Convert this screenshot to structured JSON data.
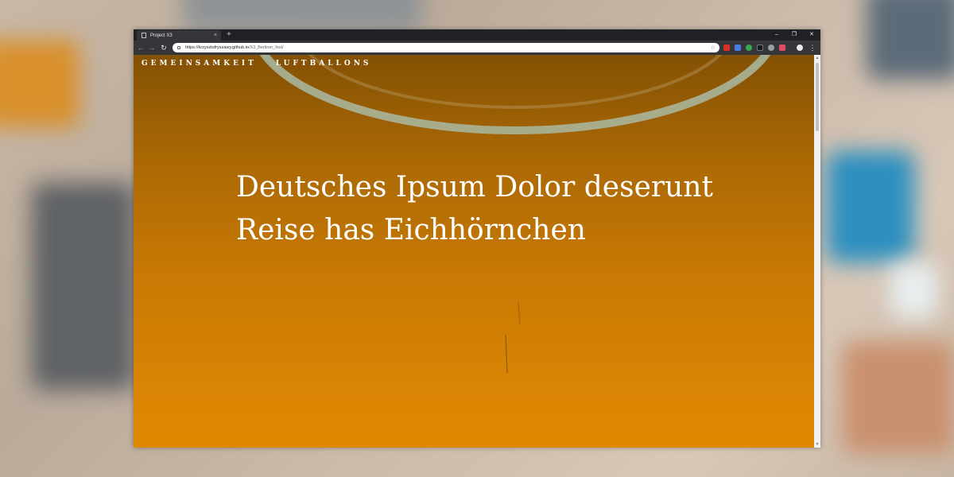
{
  "browser": {
    "tab_title": "Project X3",
    "url_host": "https://krzysztofryszawy.github.io",
    "url_path": "/X3_Berliner_fest/",
    "new_tab": "+",
    "tab_close": "×",
    "window_controls": {
      "minimize": "–",
      "restore": "❐",
      "close": "✕"
    },
    "nav_icons": {
      "back": "←",
      "forward": "→",
      "reload": "↻",
      "star": "☆",
      "menu": "⋮"
    }
  },
  "site": {
    "nav": [
      "GEMEINSAMKEIT",
      "LUFTBALLONS"
    ],
    "hero_line1": "Deutsches Ipsum Dolor deserunt",
    "hero_line2": "Reise has Eichhörnchen"
  },
  "colors": {
    "page_gradient_top": "#835104",
    "page_gradient_bottom": "#e08800",
    "chrome_dark": "#202124",
    "text_white": "#ffffff"
  }
}
